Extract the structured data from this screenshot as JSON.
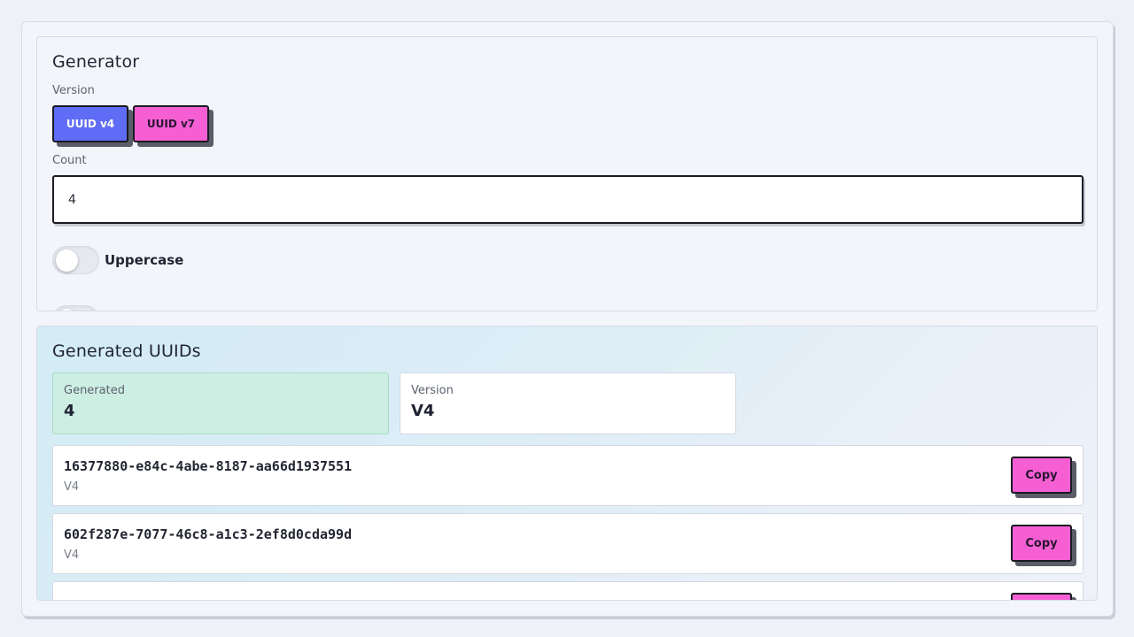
{
  "generator": {
    "title": "Generator",
    "version_label": "Version",
    "version_options": [
      "UUID v4",
      "UUID v7"
    ],
    "selected_version": "UUID v4",
    "count_label": "Count",
    "count_value": "4",
    "toggles": [
      {
        "label": "Uppercase",
        "on": false
      },
      {
        "label": "",
        "on": false
      }
    ]
  },
  "results": {
    "title": "Generated UUIDs",
    "stats": {
      "generated_label": "Generated",
      "generated_value": "4",
      "version_label": "Version",
      "version_value": "V4"
    },
    "uuids": [
      {
        "value": "16377880-e84c-4abe-8187-aa66d1937551",
        "version": "V4",
        "copy_label": "Copy"
      },
      {
        "value": "602f287e-7077-46c8-a1c3-2ef8d0cda99d",
        "version": "V4",
        "copy_label": "Copy"
      },
      {
        "value": "",
        "version": "",
        "copy_label": ""
      }
    ]
  },
  "colors": {
    "primary": "#5f6cf5",
    "accent": "#f65fd4",
    "success_bg": "#cdeee3"
  }
}
